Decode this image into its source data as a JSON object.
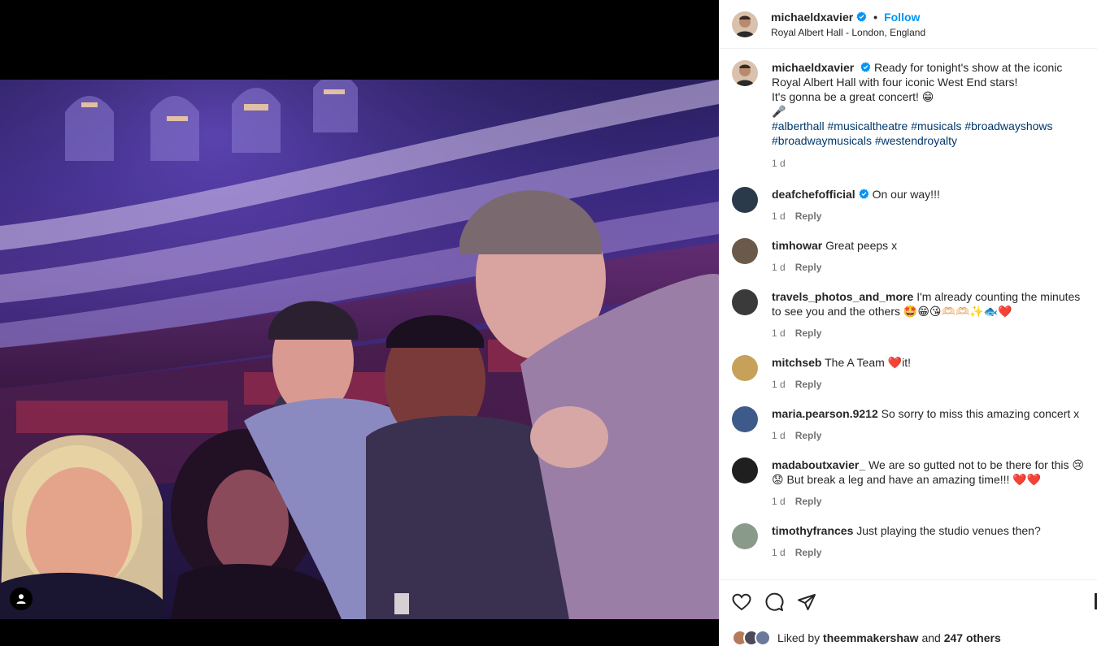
{
  "post": {
    "username": "michaeldxavier",
    "follow_label": "Follow",
    "separator": "•",
    "location": "Royal Albert Hall - London, England"
  },
  "caption": {
    "username": "michaeldxavier",
    "line1": "Ready for tonight's show at the iconic Royal Albert Hall with four iconic West End stars!",
    "line2": "It's gonna be a great concert! 😁",
    "line3": "🎤",
    "hashtags": "#alberthall #musicaltheatre #musicals #broadwayshows #broadwaymusicals #westendroyalty",
    "time": "1 d"
  },
  "comments": [
    {
      "username": "deafchefofficial",
      "verified": true,
      "text": "On our way!!!",
      "time": "1 d",
      "reply": "Reply",
      "avatar_color": "#2b3a4a"
    },
    {
      "username": "timhowar",
      "verified": false,
      "text": "Great peeps x",
      "time": "1 d",
      "reply": "Reply",
      "avatar_color": "#6b5a4a"
    },
    {
      "username": "travels_photos_and_more",
      "verified": false,
      "text": "I'm already counting the minutes to see you and the others 🤩😁😘🫶🏻🫶🏻✨🐟❤️",
      "time": "1 d",
      "reply": "Reply",
      "avatar_color": "#3a3a3a"
    },
    {
      "username": "mitchseb",
      "verified": false,
      "text": "The A Team ❤️it!",
      "time": "1 d",
      "reply": "Reply",
      "avatar_color": "#c7a15a"
    },
    {
      "username": "maria.pearson.9212",
      "verified": false,
      "text": "So sorry to miss this amazing concert x",
      "time": "1 d",
      "reply": "Reply",
      "avatar_color": "#3d5a8a"
    },
    {
      "username": "madaboutxavier_",
      "verified": false,
      "text": "We are so gutted not to be there for this 😢😟 But break a leg and have an amazing time!!! ❤️❤️",
      "time": "1 d",
      "reply": "Reply",
      "avatar_color": "#1f1f1f"
    },
    {
      "username": "timothyfrances",
      "verified": false,
      "text": "Just playing the studio venues then?",
      "time": "1 d",
      "reply": "Reply",
      "avatar_color": "#8a9a8a"
    }
  ],
  "likes": {
    "prefix": "Liked by",
    "user": "theemmakershaw",
    "connector": "and",
    "others": "247 others"
  },
  "colors": {
    "accent": "#0095f6",
    "hashtag": "#00376b",
    "muted": "#737373",
    "verified": "#0095f6"
  },
  "icons": {
    "like": "heart-icon",
    "comment": "comment-bubble-icon",
    "share": "paper-plane-icon",
    "user_tag": "user-tag-icon"
  }
}
